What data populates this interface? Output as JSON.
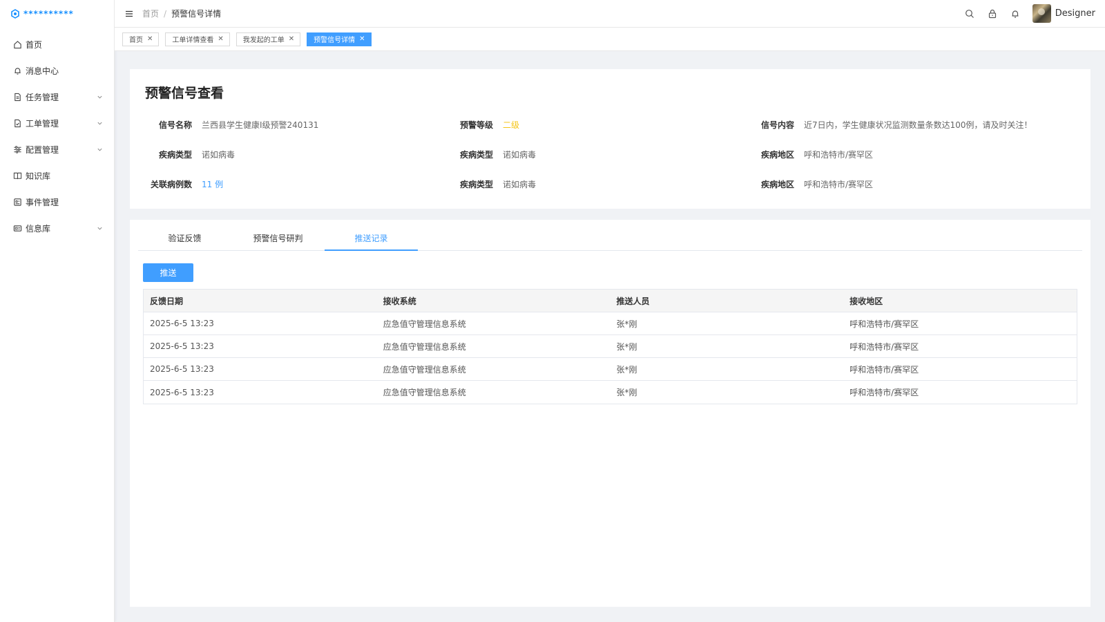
{
  "app": {
    "logo_text": "**********"
  },
  "sidebar": {
    "items": [
      {
        "label": "首页",
        "icon": "home-icon",
        "has_arrow": false
      },
      {
        "label": "消息中心",
        "icon": "bell-icon",
        "has_arrow": false
      },
      {
        "label": "任务管理",
        "icon": "document-icon",
        "has_arrow": true
      },
      {
        "label": "工单管理",
        "icon": "file-check-icon",
        "has_arrow": true
      },
      {
        "label": "配置管理",
        "icon": "sliders-icon",
        "has_arrow": true
      },
      {
        "label": "知识库",
        "icon": "book-icon",
        "has_arrow": false
      },
      {
        "label": "事件管理",
        "icon": "event-icon",
        "has_arrow": false
      },
      {
        "label": "信息库",
        "icon": "id-card-icon",
        "has_arrow": true
      }
    ]
  },
  "header": {
    "breadcrumb": {
      "home": "首页",
      "separator": "/",
      "current": "预警信号详情"
    },
    "username": "Designer"
  },
  "tags": [
    {
      "label": "首页",
      "active": false
    },
    {
      "label": "工单详情查看",
      "active": false
    },
    {
      "label": "我发起的工单",
      "active": false
    },
    {
      "label": "预警信号详情",
      "active": true
    }
  ],
  "detail": {
    "title": "预警信号查看",
    "fields": {
      "signal_name": {
        "key": "信号名称",
        "value": "兰西县学生健康I级预警240131"
      },
      "warning_level": {
        "key": "预警等级",
        "value": "二级"
      },
      "signal_content": {
        "key": "信号内容",
        "value": "近7日内，学生健康状况监测数量条数达100例，请及时关注！"
      },
      "disease_type_1": {
        "key": "疾病类型",
        "value": "诺如病毒"
      },
      "disease_type_2": {
        "key": "疾病类型",
        "value": "诺如病毒"
      },
      "disease_area_1": {
        "key": "疾病地区",
        "value": "呼和浩特市/赛罕区"
      },
      "related_cases": {
        "key": "关联病例数",
        "value": "11 例"
      },
      "disease_type_3": {
        "key": "疾病类型",
        "value": "诺如病毒"
      },
      "disease_area_2": {
        "key": "疾病地区",
        "value": "呼和浩特市/赛罕区"
      }
    }
  },
  "tabs": [
    {
      "label": "验证反馈",
      "active": false
    },
    {
      "label": "预警信号研判",
      "active": false
    },
    {
      "label": "推送记录",
      "active": true
    }
  ],
  "push_button": "推送",
  "table": {
    "headers": [
      "反馈日期",
      "接收系统",
      "推送人员",
      "接收地区"
    ],
    "rows": [
      [
        "2025-6-5 13:23",
        "应急值守管理信息系统",
        "张*刚",
        "呼和浩特市/赛罕区"
      ],
      [
        "2025-6-5 13:23",
        "应急值守管理信息系统",
        "张*刚",
        "呼和浩特市/赛罕区"
      ],
      [
        "2025-6-5 13:23",
        "应急值守管理信息系统",
        "张*刚",
        "呼和浩特市/赛罕区"
      ],
      [
        "2025-6-5 13:23",
        "应急值守管理信息系统",
        "张*刚",
        "呼和浩特市/赛罕区"
      ]
    ]
  },
  "colors": {
    "primary": "#409eff",
    "level_yellow": "#f5c518",
    "logo_blue": "#1890ff"
  }
}
